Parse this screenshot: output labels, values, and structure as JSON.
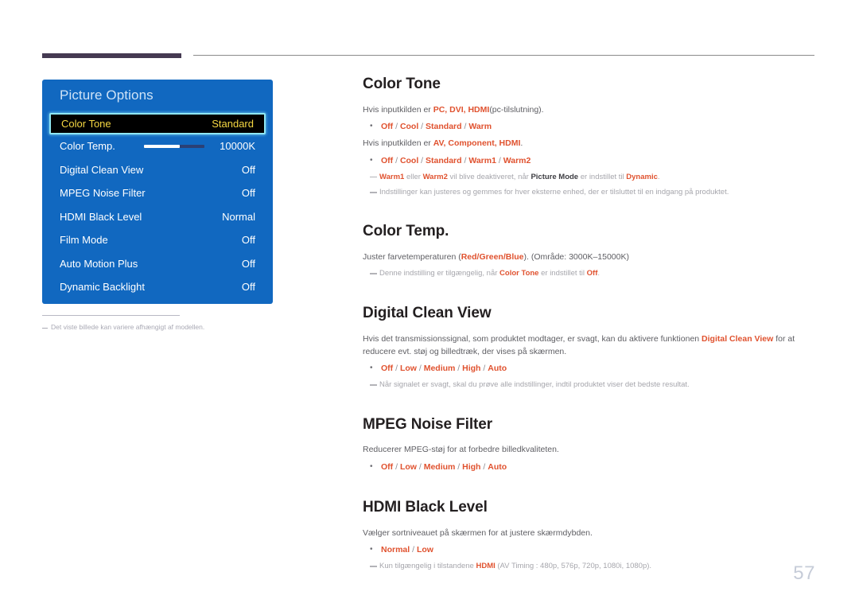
{
  "page": {
    "number": "57"
  },
  "osd": {
    "title": "Picture Options",
    "rows": [
      {
        "label": "Color Tone",
        "value": "Standard",
        "selected": true,
        "slider": false
      },
      {
        "label": "Color Temp.",
        "value": "10000K",
        "selected": false,
        "slider": true,
        "slider_fill_percent": 59
      },
      {
        "label": "Digital Clean View",
        "value": "Off",
        "selected": false,
        "slider": false
      },
      {
        "label": "MPEG Noise Filter",
        "value": "Off",
        "selected": false,
        "slider": false
      },
      {
        "label": "HDMI Black Level",
        "value": "Normal",
        "selected": false,
        "slider": false
      },
      {
        "label": "Film Mode",
        "value": "Off",
        "selected": false,
        "slider": false
      },
      {
        "label": "Auto Motion Plus",
        "value": "Off",
        "selected": false,
        "slider": false
      },
      {
        "label": "Dynamic Backlight",
        "value": "Off",
        "selected": false,
        "slider": false
      }
    ],
    "footnote": "Det viste billede kan variere afhængigt af modellen."
  },
  "doc": {
    "color_tone": {
      "heading": "Color Tone",
      "para_pc_pre": "Hvis inputkilden er ",
      "para_pc_sources": "PC, DVI, HDMI",
      "para_pc_post": "(pc-tilslutning).",
      "options_pc": "Off / Cool / Standard / Warm",
      "para_av_pre": "Hvis inputkilden er ",
      "para_av_sources": "AV, Component, HDMI",
      "para_av_post": ".",
      "options_av": "Off / Cool / Standard / Warm1 / Warm2",
      "note1_a": "Warm1",
      "note1_b": " eller ",
      "note1_c": "Warm2",
      "note1_d": " vil blive deaktiveret, når ",
      "note1_e": "Picture Mode",
      "note1_f": " er indstillet til ",
      "note1_g": "Dynamic",
      "note1_h": ".",
      "note2": "Indstillinger kan justeres og gemmes for hver eksterne enhed, der er tilsluttet til en indgang på produktet."
    },
    "color_temp": {
      "heading": "Color Temp.",
      "para_pre": "Juster farvetemperaturen (",
      "para_rgb": "Red/Green/Blue",
      "para_post": "). (Område: 3000K–15000K)",
      "note_a": "Denne indstilling er tilgængelig, når ",
      "note_b": "Color Tone",
      "note_c": " er indstillet til ",
      "note_d": "Off",
      "note_e": "."
    },
    "digital_clean_view": {
      "heading": "Digital Clean View",
      "para_pre": "Hvis det transmissionssignal, som produktet modtager, er svagt, kan du aktivere funktionen ",
      "para_term": "Digital Clean View",
      "para_post": " for at reducere evt. støj og billedtræk, der vises på skærmen.",
      "options": "Off / Low / Medium / High / Auto",
      "note": "Når signalet er svagt, skal du prøve alle indstillinger, indtil produktet viser det bedste resultat."
    },
    "mpeg_noise_filter": {
      "heading": "MPEG Noise Filter",
      "para": "Reducerer MPEG-støj for at forbedre billedkvaliteten.",
      "options": "Off / Low / Medium / High / Auto"
    },
    "hdmi_black_level": {
      "heading": "HDMI Black Level",
      "para": "Vælger sortniveauet på skærmen for at justere skærmdybden.",
      "options": "Normal / Low",
      "note_a": "Kun tilgængelig i tilstandene ",
      "note_b": "HDMI",
      "note_c": " (AV Timing : 480p, 576p, 720p, 1080i, 1080p)."
    }
  },
  "colors": {
    "osd_blue": "#1168c0",
    "accent": "#e0522f",
    "selected_text": "#f5d742",
    "header_bar": "#453a52",
    "page_number": "#c6ccd8"
  }
}
